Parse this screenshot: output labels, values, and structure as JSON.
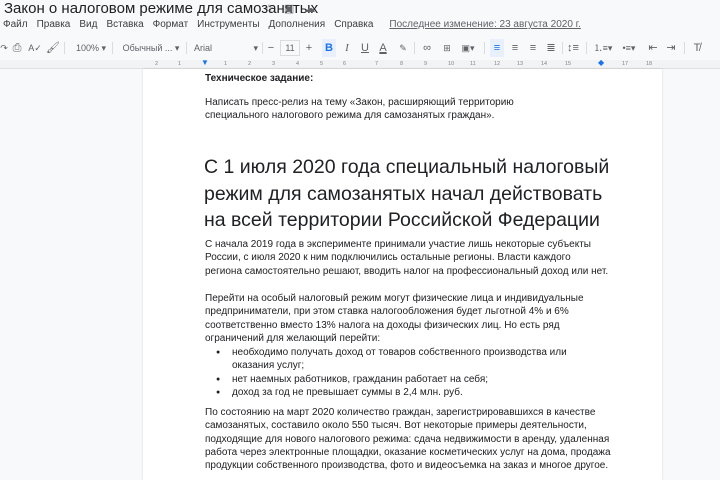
{
  "title": "Закон о налоговом режиме для самозанятых",
  "title_icons": [
    "star-icon",
    "move-to-folder-icon",
    "cloud-status-icon"
  ],
  "menu": [
    "Файл",
    "Правка",
    "Вид",
    "Вставка",
    "Формат",
    "Инструменты",
    "Дополнения",
    "Справка"
  ],
  "last_edit": "Последнее изменение: 23 августа 2020 г.",
  "toolbar": {
    "zoom": "100%",
    "style": "Обычный ...",
    "font": "Arial",
    "size": "11",
    "minus": "−",
    "plus": "+",
    "bold": "B",
    "italic": "I",
    "underline": "U",
    "color": "A"
  },
  "ruler": [
    "2",
    "1",
    "1",
    "2",
    "3",
    "4",
    "5",
    "6",
    "7",
    "8",
    "9",
    "10",
    "11",
    "12",
    "13",
    "14",
    "15",
    "17",
    "18"
  ],
  "doc": {
    "spec_title": "Техническое задание:",
    "spec_text": "Написать пресс-релиз на тему «Закон, расширяющий территорию специального налогового режима для самозанятых граждан».",
    "heading": "С 1 июля 2020 года специальный налоговый режим для самозанятых начал действовать на всей территории Российской Федерации",
    "p1": "С начала 2019 года в эксперименте принимали участие лишь некоторые субъекты России, с июля 2020 к ним подключились остальные регионы. Власти каждого региона самостоятельно решают, вводить налог на профессиональный доход или нет.",
    "p2": "Перейти на особый налоговый режим могут физические лица и индивидуальные предприниматели, при этом ставка налогообложения будет льготной 4% и 6% соответственно вместо 13% налога на доходы физических лиц. Но есть ряд ограничений для желающий перейти:",
    "bullets": [
      "необходимо получать доход от товаров собственного производства или оказания услуг;",
      "нет наемных работников, гражданин работает на себя;",
      "доход за год не превышает суммы в 2,4 млн. руб."
    ],
    "p3": "По состоянию на март 2020 количество граждан, зарегистрировавшихся в качестве самозанятых, составило около 550 тысяч. Вот некоторые примеры деятельности, подходящие для нового налогового режима: сдача недвижимости в аренду, удаленная работа через электронные площадки, оказание косметических услуг на дома, продажа продукции собственного производства, фото и видеосъемка на заказ и многое другое."
  },
  "colors": {
    "accent": "#1a73e8"
  }
}
